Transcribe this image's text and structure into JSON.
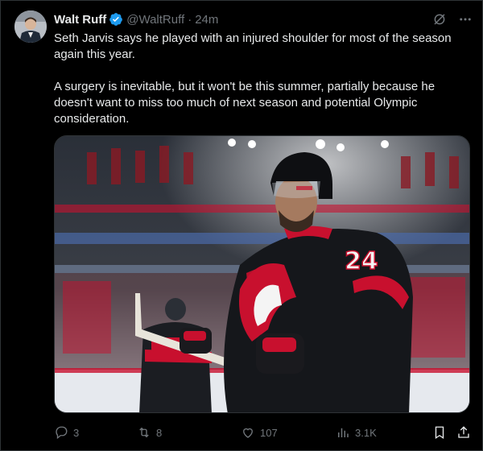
{
  "tweet": {
    "author_name": "Walt Ruff",
    "handle": "@WaltRuff",
    "separator": "·",
    "time": "24m",
    "paragraphs": [
      "Seth Jarvis says he played with an injured shoulder for most of the season again this year.",
      "A surgery is inevitable, but it won't be this summer, partially because he doesn't want to miss too much of next season and potential Olympic consideration."
    ],
    "jersey_number": "24",
    "verified_icon": "verified-badge-icon",
    "grok_icon": "grok-icon",
    "more_icon": "more-icon"
  },
  "actions": {
    "replies": "3",
    "reposts": "8",
    "likes": "107",
    "views": "3.1K"
  },
  "colors": {
    "background": "#000000",
    "text": "#e7e9ea",
    "muted": "#71767b",
    "verified": "#1d9bf0",
    "jersey_red": "#c8102e"
  }
}
